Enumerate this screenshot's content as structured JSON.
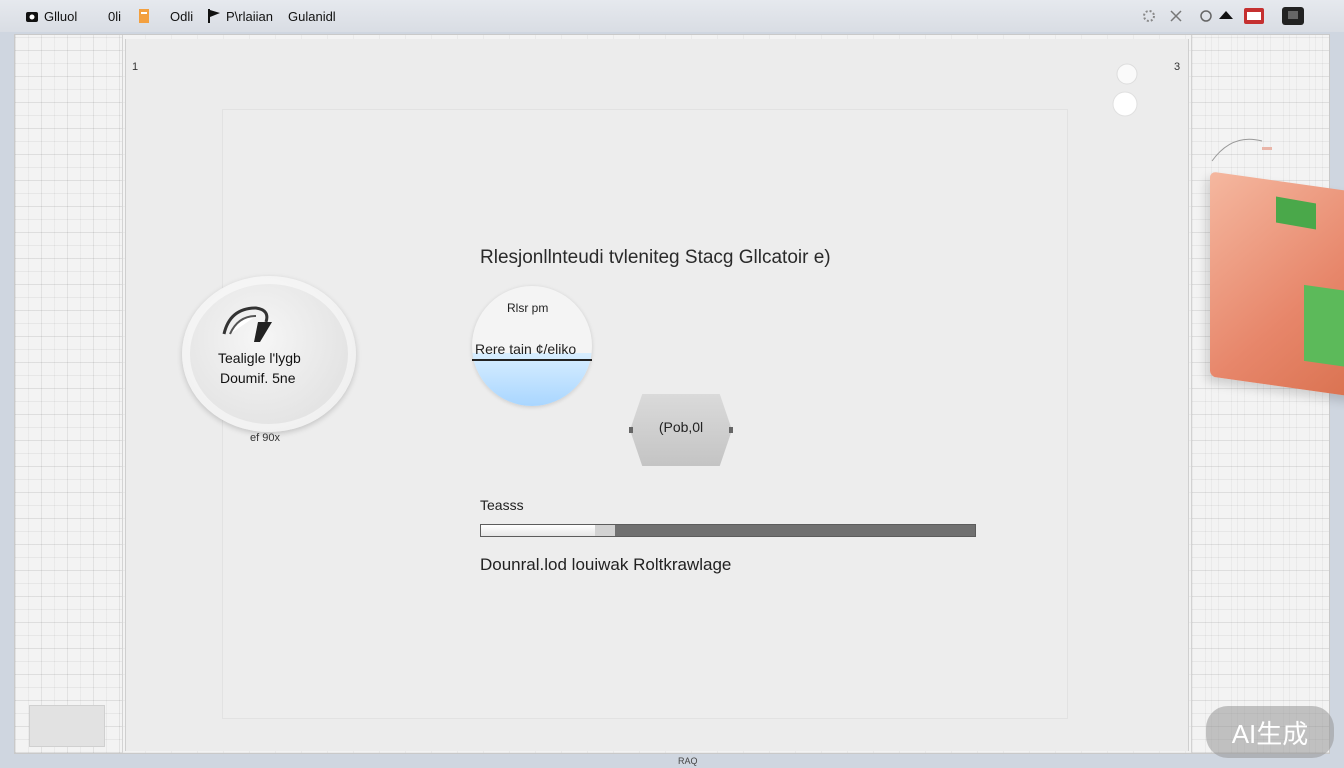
{
  "topbar": {
    "items": [
      {
        "label": "Glluol",
        "icon": "home-icon"
      },
      {
        "label": "0li",
        "icon": "folder-icon"
      },
      {
        "label": "Odli",
        "icon": "document-icon"
      },
      {
        "label": "P\\rlaiian",
        "icon": "flag-icon"
      },
      {
        "label": "Gulanidl",
        "icon": ""
      }
    ],
    "right_icons": [
      "settings-icon",
      "close-icon",
      "circle-icon",
      "bird-icon",
      "badge-icon",
      "account-icon"
    ]
  },
  "rulers": {
    "left_num": "1",
    "right_num": "3"
  },
  "disc": {
    "line1": "Tealigle l'lygb",
    "line2": "Doumif. 5ne",
    "sub": "ef 90x"
  },
  "main": {
    "heading": "Rlesjonllnteudi tvleniteg Stacg Gllcatoir  e)",
    "knob_top": "Rlsr pm",
    "knob_label": "Rere tain ¢/eliko",
    "knob_fill_fraction": 0.44,
    "octagon_label": "(Pob,0l",
    "progress_label": "Teasss",
    "progress_value": 0.23,
    "download_text": "Dounral.lod louiwak Roltkrawlage"
  },
  "watermark": "AI生成",
  "bottom_caption": "RAQ",
  "colors": {
    "accent_blue": "#a9d6ff",
    "orange": "#e7866a",
    "green": "#4aa84a"
  }
}
